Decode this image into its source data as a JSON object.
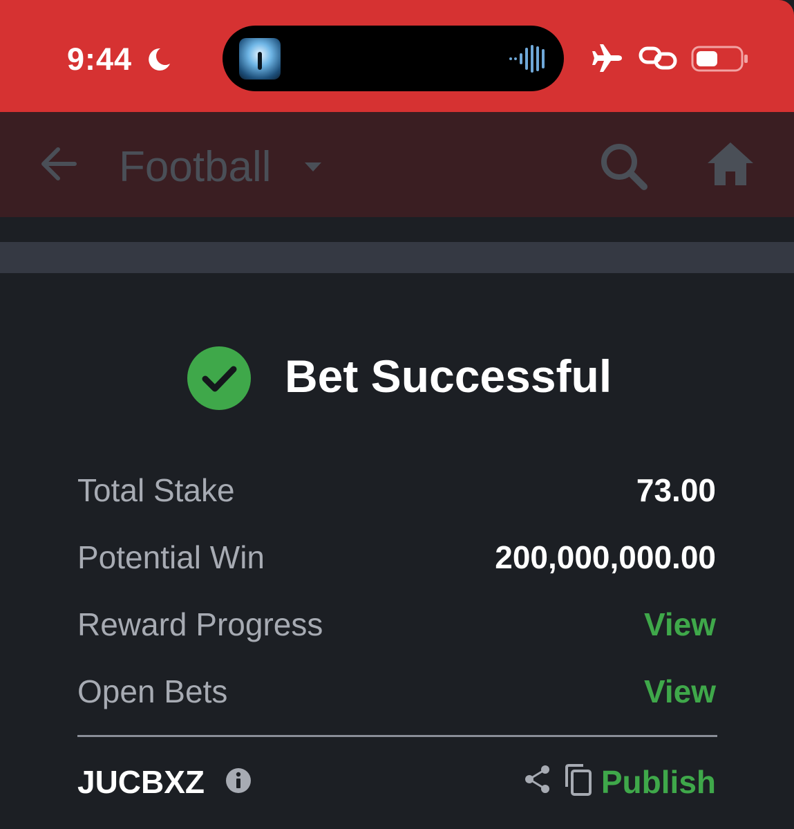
{
  "status_bar": {
    "time": "9:44",
    "icons": [
      "moon-icon",
      "airplane-icon",
      "link-icon",
      "battery-icon"
    ],
    "background": "#d63232"
  },
  "nav": {
    "title": "Football",
    "icons": [
      "back-arrow-icon",
      "caret-down-icon",
      "search-icon",
      "home-icon"
    ]
  },
  "success": {
    "title": "Bet Successful",
    "icon": "check-circle-icon",
    "color": "#3fa84a"
  },
  "details": {
    "total_stake_label": "Total Stake",
    "total_stake_value": "73.00",
    "potential_win_label": "Potential Win",
    "potential_win_value": "200,000,000.00",
    "reward_progress_label": "Reward Progress",
    "reward_progress_link": "View",
    "open_bets_label": "Open Bets",
    "open_bets_link": "View"
  },
  "booking": {
    "code": "JUCBXZ",
    "publish_label": "Publish",
    "icons": [
      "info-icon",
      "share-icon",
      "copy-icon"
    ]
  }
}
